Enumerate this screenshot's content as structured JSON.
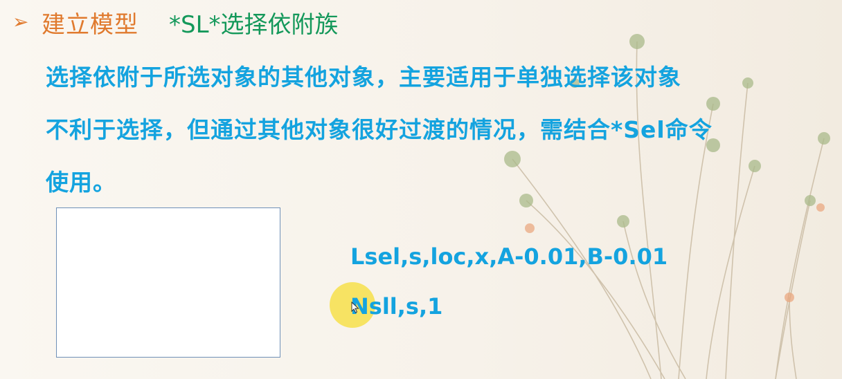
{
  "header": {
    "bullet_icon": "arrow-bullet-icon",
    "title": "建立模型",
    "command": "*SL*选择依附族"
  },
  "description": {
    "lines": [
      "选择依附于所选对象的其他对象，主要适用于单独选择该对象",
      "不利于选择，但通过其他对象很好过渡的情况，需结合*Sel命令",
      "使用。"
    ]
  },
  "commands": [
    "Lsel,s,loc,x,A-0.01,B-0.01",
    "Nsll,s,1"
  ],
  "colors": {
    "title": "#e07a2e",
    "command_title": "#14985a",
    "body_text": "#14a3df",
    "cursor_highlight": "#f6de3c"
  }
}
